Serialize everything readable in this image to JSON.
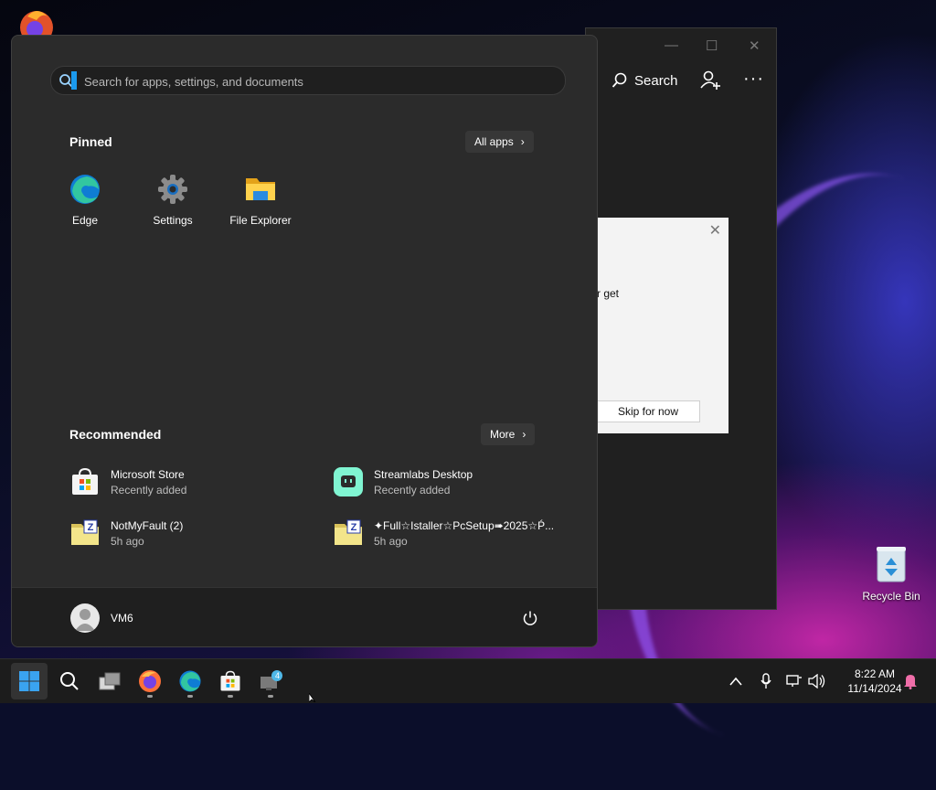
{
  "background_window": {
    "toolbar": {
      "search_label": "Search"
    },
    "dialog": {
      "text_fragment": "r get",
      "skip_label": "Skip for now"
    }
  },
  "desktop": {
    "recycle_bin_label": "Recycle Bin"
  },
  "start_menu": {
    "search": {
      "placeholder": "Search for apps, settings, and documents",
      "value": ""
    },
    "pinned": {
      "title": "Pinned",
      "all_apps_label": "All apps",
      "apps": [
        {
          "label": "Edge",
          "icon": "edge-icon"
        },
        {
          "label": "Settings",
          "icon": "gear-icon"
        },
        {
          "label": "File Explorer",
          "icon": "folder-icon"
        }
      ]
    },
    "recommended": {
      "title": "Recommended",
      "more_label": "More",
      "items": [
        {
          "title": "Microsoft Store",
          "subtitle": "Recently added",
          "icon": "store-icon"
        },
        {
          "title": "Streamlabs Desktop",
          "subtitle": "Recently added",
          "icon": "streamlabs-icon"
        },
        {
          "title": "NotMyFault (2)",
          "subtitle": "5h ago",
          "icon": "zip-folder-icon"
        },
        {
          "title": "✦Full☆Istaller☆PcSetup➠2025☆Ṕ...",
          "subtitle": "5h ago",
          "icon": "zip-folder-icon"
        }
      ]
    },
    "user": {
      "name": "VM6"
    }
  },
  "taskbar": {
    "time": "8:22 AM",
    "date": "11/14/2024",
    "apps": [
      "windows-start-icon",
      "search-icon",
      "task-view-icon",
      "firefox-icon",
      "edge-icon",
      "store-icon",
      "chat-icon"
    ],
    "chat_badge": "4"
  },
  "colors": {
    "accent": "#1b9aee",
    "start_bg": "#2b2b2b",
    "taskbar_bg": "#1c1c1c"
  }
}
